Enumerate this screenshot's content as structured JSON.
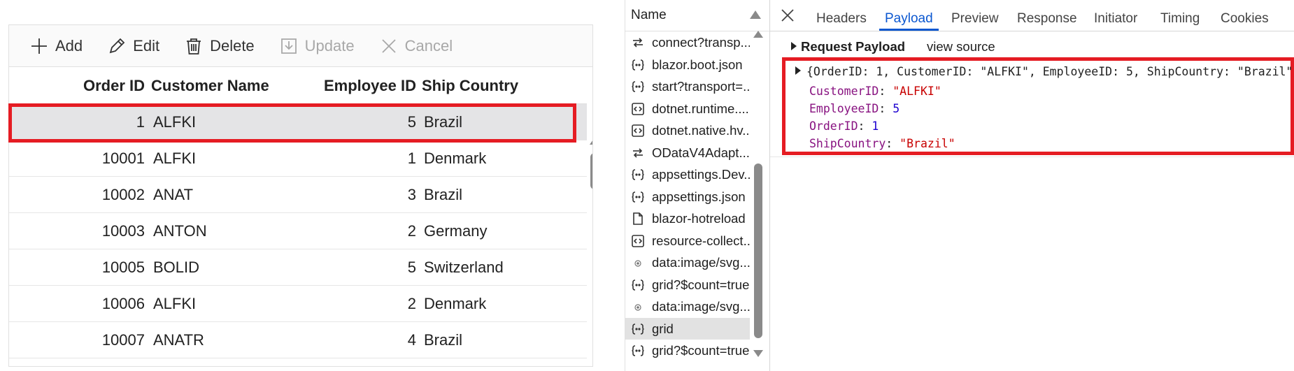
{
  "toolbar": {
    "add": "Add",
    "edit": "Edit",
    "delete": "Delete",
    "update": "Update",
    "cancel": "Cancel"
  },
  "grid": {
    "columns": [
      "Order ID",
      "Customer Name",
      "Employee ID",
      "Ship Country"
    ],
    "rows": [
      {
        "order_id": "1",
        "customer": "ALFKI",
        "employee": "5",
        "country": "Brazil"
      },
      {
        "order_id": "10001",
        "customer": "ALFKI",
        "employee": "1",
        "country": "Denmark"
      },
      {
        "order_id": "10002",
        "customer": "ANAT",
        "employee": "3",
        "country": "Brazil"
      },
      {
        "order_id": "10003",
        "customer": "ANTON",
        "employee": "2",
        "country": "Germany"
      },
      {
        "order_id": "10005",
        "customer": "BOLID",
        "employee": "5",
        "country": "Switzerland"
      },
      {
        "order_id": "10006",
        "customer": "ALFKI",
        "employee": "2",
        "country": "Denmark"
      },
      {
        "order_id": "10007",
        "customer": "ANATR",
        "employee": "4",
        "country": "Brazil"
      }
    ]
  },
  "devtools": {
    "name_header": "Name",
    "requests": [
      {
        "name": "connect?transp...",
        "icon": "websocket-icon"
      },
      {
        "name": "blazor.boot.json",
        "icon": "json-icon"
      },
      {
        "name": "start?transport=...",
        "icon": "json-icon"
      },
      {
        "name": "dotnet.runtime....",
        "icon": "script-icon"
      },
      {
        "name": "dotnet.native.hv...",
        "icon": "script-icon"
      },
      {
        "name": "ODataV4Adapt...",
        "icon": "websocket-icon"
      },
      {
        "name": "appsettings.Dev...",
        "icon": "json-icon"
      },
      {
        "name": "appsettings.json",
        "icon": "json-icon"
      },
      {
        "name": "blazor-hotreload",
        "icon": "document-icon"
      },
      {
        "name": "resource-collect...",
        "icon": "script-icon"
      },
      {
        "name": "data:image/svg...",
        "icon": "image-icon"
      },
      {
        "name": "grid?$count=true",
        "icon": "json-icon"
      },
      {
        "name": "data:image/svg...",
        "icon": "image-icon"
      },
      {
        "name": "grid",
        "icon": "json-icon"
      },
      {
        "name": "grid?$count=true",
        "icon": "json-icon"
      }
    ],
    "tabs": [
      "Headers",
      "Payload",
      "Preview",
      "Response",
      "Initiator",
      "Timing",
      "Cookies"
    ],
    "active_tab": "Payload",
    "payload_title": "Request Payload",
    "view_source": "view source",
    "summary": "{OrderID: 1, CustomerID: \"ALFKI\", EmployeeID: 5, ShipCountry: \"Brazil\"}",
    "props": [
      {
        "key": "CustomerID",
        "value": "\"ALFKI\"",
        "type": "string"
      },
      {
        "key": "EmployeeID",
        "value": "5",
        "type": "number"
      },
      {
        "key": "OrderID",
        "value": "1",
        "type": "number"
      },
      {
        "key": "ShipCountry",
        "value": "\"Brazil\"",
        "type": "string"
      }
    ]
  },
  "colors": {
    "highlight": "#e51c23",
    "accent": "#0b57d0",
    "selected_row": "#e4e4e6",
    "json_key": "#881280",
    "json_string": "#c80000",
    "json_number": "#1c00cf"
  }
}
